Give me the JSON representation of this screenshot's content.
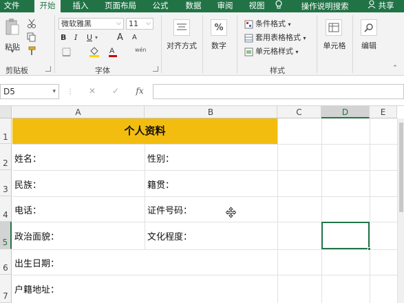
{
  "tabs": [
    {
      "label": "文件",
      "active": false
    },
    {
      "label": "开始",
      "active": true
    },
    {
      "label": "插入",
      "active": false
    },
    {
      "label": "页面布局",
      "active": false
    },
    {
      "label": "公式",
      "active": false
    },
    {
      "label": "数据",
      "active": false
    },
    {
      "label": "审阅",
      "active": false
    },
    {
      "label": "视图",
      "active": false
    }
  ],
  "tell_me": "操作说明搜索",
  "share": "共享",
  "ribbon": {
    "clipboard": {
      "paste": "粘贴",
      "group": "剪贴板"
    },
    "font": {
      "name": "微软雅黑",
      "size": "11",
      "bold": "B",
      "italic": "I",
      "underline": "U",
      "grow": "A",
      "shrink": "A",
      "group": "字体",
      "wen": "wén"
    },
    "alignment": {
      "label": "对齐方式"
    },
    "number": {
      "label": "数字",
      "symbol": "%"
    },
    "styles": {
      "conditional": "条件格式",
      "table": "套用表格格式",
      "cell": "单元格样式",
      "group": "样式"
    },
    "cells": {
      "label": "单元格"
    },
    "editing": {
      "label": "编辑"
    }
  },
  "formula_bar": {
    "namebox": "D5",
    "fx": "fx",
    "cancel": "✕",
    "enter": "✓",
    "content": ""
  },
  "columns": [
    "A",
    "B",
    "C",
    "D",
    "E"
  ],
  "selected_column": "D",
  "rows": [
    "1",
    "2",
    "3",
    "4",
    "5",
    "6",
    "7"
  ],
  "selected_row": "5",
  "title": "个人资料",
  "cells": {
    "a2": "姓名：",
    "b2": "性别：",
    "a3": "民族：",
    "b3": "籍贯：",
    "a4": "电话：",
    "b4": "证件号码：",
    "a5": "政治面貌：",
    "b5": "文化程度：",
    "a6": "出生日期：",
    "a7": "户籍地址："
  },
  "colors": {
    "brand": "#217346",
    "title_fill": "#f3bd0f"
  }
}
